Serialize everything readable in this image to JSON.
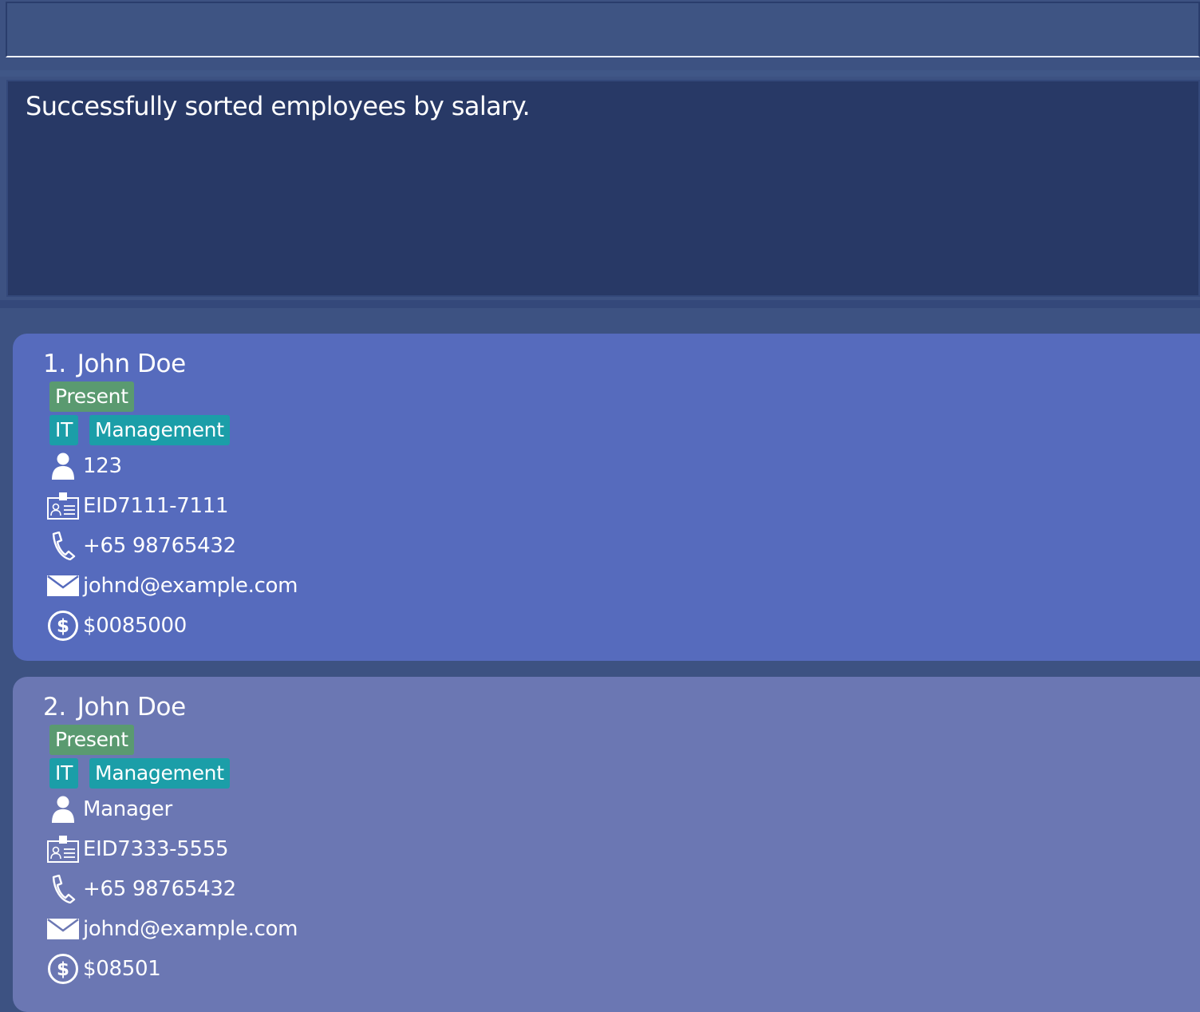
{
  "command_box": {
    "value": "",
    "placeholder": ""
  },
  "result_display": {
    "message": "Successfully sorted employees by salary."
  },
  "employees": [
    {
      "index": "1.",
      "name": "John Doe",
      "status": "Present",
      "departments": [
        "IT",
        "Management"
      ],
      "role": "123",
      "employee_id": "EID7111-7111",
      "phone": "+65 98765432",
      "email": "johnd@example.com",
      "salary": "$0085000"
    },
    {
      "index": "2.",
      "name": "John Doe",
      "status": "Present",
      "departments": [
        "IT",
        "Management"
      ],
      "role": "Manager",
      "employee_id": "EID7333-5555",
      "phone": "+65 98765432",
      "email": "johnd@example.com",
      "salary": "$08501"
    }
  ],
  "icons": {
    "role": "person-icon",
    "employee_id": "id-card-icon",
    "phone": "phone-icon",
    "email": "mail-icon",
    "salary": "dollar-circle-icon"
  },
  "colors": {
    "background": "#3d5282",
    "result_background": "#283966",
    "card_selected": "#566bbd",
    "card_default": "#6b77b3",
    "status_tag": "#5a9a70",
    "department_tag": "#1b9ea8"
  }
}
